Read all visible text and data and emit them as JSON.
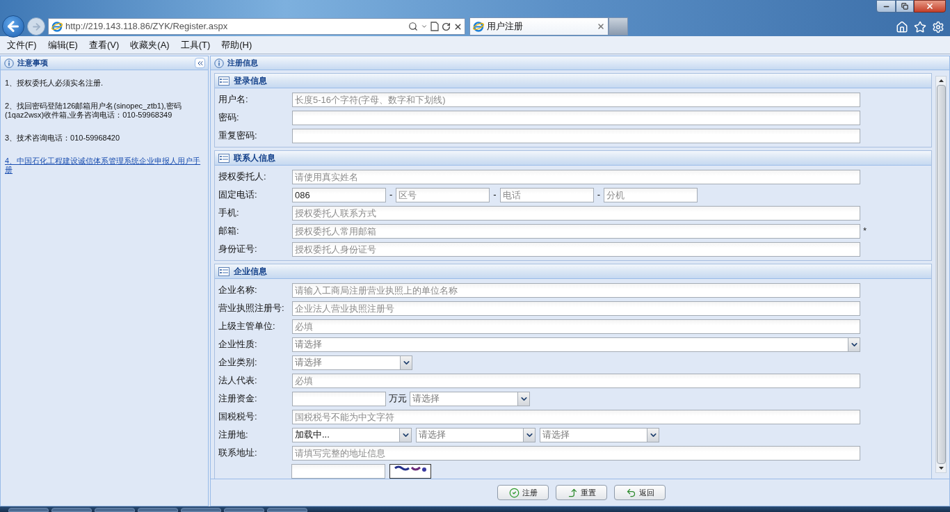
{
  "browser": {
    "url": "http://219.143.118.86/ZYK/Register.aspx",
    "tab": {
      "title": "用户注册",
      "selected": true
    },
    "menu": [
      "文件(F)",
      "编辑(E)",
      "查看(V)",
      "收藏夹(A)",
      "工具(T)",
      "帮助(H)"
    ]
  },
  "notes_panel": {
    "title": "注意事项",
    "notes": [
      {
        "kind": "text",
        "text": "1、授权委托人必须实名注册."
      },
      {
        "kind": "text",
        "text": "2、找回密码登陆126邮箱用户名(sinopec_ztb1),密码(1qaz2wsx)收件箱,业务咨询电话：010-59968349"
      },
      {
        "kind": "text",
        "text": "3、技术咨询电话：010-59968420"
      },
      {
        "kind": "link",
        "text": "4、中国石化工程建设诚信体系管理系统企业申报人用户手册"
      }
    ]
  },
  "form": {
    "title": "注册信息",
    "sections": [
      {
        "title": "登录信息",
        "rows": [
          {
            "kind": "text",
            "label": "用户名:",
            "placeholder": "长度5-16个字符(字母、数字和下划线)"
          },
          {
            "kind": "text",
            "label": "密码:"
          },
          {
            "kind": "text",
            "label": "重复密码:"
          }
        ]
      },
      {
        "title": "联系人信息",
        "rows": [
          {
            "kind": "text",
            "label": "授权委托人:",
            "placeholder": "请使用真实姓名"
          },
          {
            "kind": "phone",
            "label": "固定电话:",
            "parts": [
              {
                "value": "086"
              },
              {
                "separator": "-",
                "placeholder": "区号"
              },
              {
                "separator": "-",
                "placeholder": "电话"
              },
              {
                "separator": "-",
                "placeholder": "分机"
              }
            ]
          },
          {
            "kind": "text",
            "label": "手机:",
            "placeholder": "授权委托人联系方式"
          },
          {
            "kind": "text",
            "label": "邮箱:",
            "placeholder": "授权委托人常用邮箱",
            "required_mark": "*"
          },
          {
            "kind": "text",
            "label": "身份证号:",
            "placeholder": "授权委托人身份证号"
          }
        ]
      },
      {
        "title": "企业信息",
        "rows": [
          {
            "kind": "text",
            "label": "企业名称:",
            "placeholder": "请输入工商局注册营业执照上的单位名称"
          },
          {
            "kind": "text",
            "label": "营业执照注册号:",
            "placeholder": "企业法人营业执照注册号"
          },
          {
            "kind": "text",
            "label": "上级主管单位:",
            "placeholder": "必填"
          },
          {
            "kind": "select",
            "label": "企业性质:",
            "placeholder": "请选择"
          },
          {
            "kind": "short_select",
            "label": "企业类别:",
            "placeholder": "请选择"
          },
          {
            "kind": "text",
            "label": "法人代表:",
            "placeholder": "必填"
          },
          {
            "kind": "money",
            "label": "注册资金:",
            "unit": "万元",
            "select": {
              "placeholder": "请选择"
            }
          },
          {
            "kind": "text",
            "label": "国税税号:",
            "placeholder": "国税税号不能为中文字符"
          },
          {
            "kind": "region",
            "label": "注册地:",
            "selects": [
              {
                "value": "加载中..."
              },
              {
                "placeholder": "请选择"
              },
              {
                "placeholder": "请选择"
              }
            ]
          },
          {
            "kind": "text",
            "label": "联系地址:",
            "placeholder": "请填写完整的地址信息"
          },
          {
            "kind": "captcha"
          }
        ]
      }
    ],
    "buttons": [
      {
        "kind": "submit",
        "label": "注册"
      },
      {
        "kind": "reset",
        "label": "重置"
      },
      {
        "kind": "back",
        "label": "返回"
      }
    ]
  }
}
